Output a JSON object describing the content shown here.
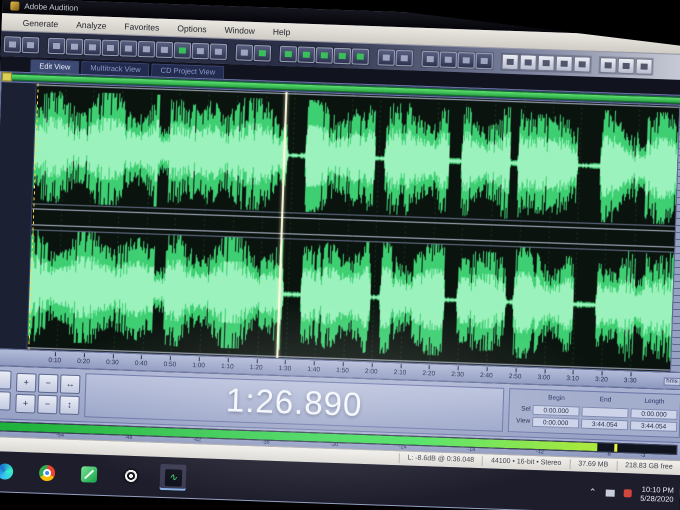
{
  "app": {
    "title": "Adobe Audition"
  },
  "menu": {
    "items": [
      "Generate",
      "Analyze",
      "Favorites",
      "Options",
      "Window",
      "Help"
    ]
  },
  "toolbar": {
    "groups": [
      [
        "plain",
        "plain"
      ],
      [
        "plain",
        "plain",
        "plain",
        "plain",
        "plain",
        "plain",
        "plain",
        "green",
        "plain",
        "plain"
      ],
      [
        "plain",
        "green"
      ],
      [
        "green",
        "green",
        "green",
        "green",
        "green"
      ],
      [
        "plain",
        "plain"
      ],
      [
        "plain",
        "plain",
        "plain",
        "plain"
      ],
      [
        "light",
        "light",
        "light",
        "light",
        "light"
      ],
      [
        "light",
        "light",
        "light"
      ]
    ]
  },
  "tabs": [
    {
      "label": "Edit View",
      "active": true
    },
    {
      "label": "Multitrack View",
      "active": false
    },
    {
      "label": "CD Project View",
      "active": false
    }
  ],
  "timeline": {
    "duration_s": 224.054,
    "unit": "hms",
    "labels": [
      {
        "t": 10,
        "text": "0:10"
      },
      {
        "t": 20,
        "text": "0:20"
      },
      {
        "t": 30,
        "text": "0:30"
      },
      {
        "t": 40,
        "text": "0:40"
      },
      {
        "t": 50,
        "text": "0:50"
      },
      {
        "t": 60,
        "text": "1:00"
      },
      {
        "t": 70,
        "text": "1:10"
      },
      {
        "t": 80,
        "text": "1:20"
      },
      {
        "t": 90,
        "text": "1:30"
      },
      {
        "t": 100,
        "text": "1:40"
      },
      {
        "t": 110,
        "text": "1:50"
      },
      {
        "t": 120,
        "text": "2:00"
      },
      {
        "t": 130,
        "text": "2:10"
      },
      {
        "t": 140,
        "text": "2:20"
      },
      {
        "t": 150,
        "text": "2:30"
      },
      {
        "t": 160,
        "text": "2:40"
      },
      {
        "t": 170,
        "text": "2:50"
      },
      {
        "t": 180,
        "text": "3:00"
      },
      {
        "t": 190,
        "text": "3:10"
      },
      {
        "t": 200,
        "text": "3:20"
      },
      {
        "t": 210,
        "text": "3:30"
      }
    ]
  },
  "wave": {
    "seed": 1337,
    "playhead_s": 86.89,
    "gaps": [
      [
        88.3,
        94.2
      ],
      [
        118.8,
        121.8
      ],
      [
        144.6,
        148.6
      ],
      [
        166.0,
        168.2
      ],
      [
        189.5,
        197.0
      ]
    ],
    "low": [
      [
        43.0,
        47.0,
        0.45
      ],
      [
        210.5,
        213.0,
        0.5
      ]
    ],
    "color": "#3ecf72",
    "color_core": "#9bf2bc",
    "background": "#0b130e"
  },
  "zoom": {
    "glyphs": [
      "+",
      "−",
      "↔",
      "+",
      "−",
      "↕"
    ]
  },
  "time_display": {
    "value": "1:26.890"
  },
  "selview": {
    "headers": [
      "Begin",
      "End",
      "Length"
    ],
    "rows": [
      {
        "label": "Sel",
        "begin": "0:00.000",
        "end": "",
        "length": "0:00.000"
      },
      {
        "label": "View",
        "begin": "0:00.000",
        "end": "3:44.054",
        "length": "3:44.054"
      }
    ]
  },
  "meter": {
    "labels": [
      "-54",
      "-48",
      "-42",
      "-36",
      "-30",
      "-24",
      "-18",
      "-12",
      "-6",
      "-3"
    ],
    "level_frac": 0.885,
    "peak_frac": 0.91
  },
  "status": {
    "segments": [
      "L: -8.6dB @ 0:36.048",
      "44100 • 16-bit • Stereo",
      "37.69 MB",
      "218.83 GB free"
    ]
  },
  "taskbar": {
    "icons": [
      "edge",
      "chrome",
      "greenapp",
      "target",
      "audition"
    ],
    "active": "audition",
    "tray_time": "10:10 PM",
    "tray_date": "5/28/2020"
  }
}
